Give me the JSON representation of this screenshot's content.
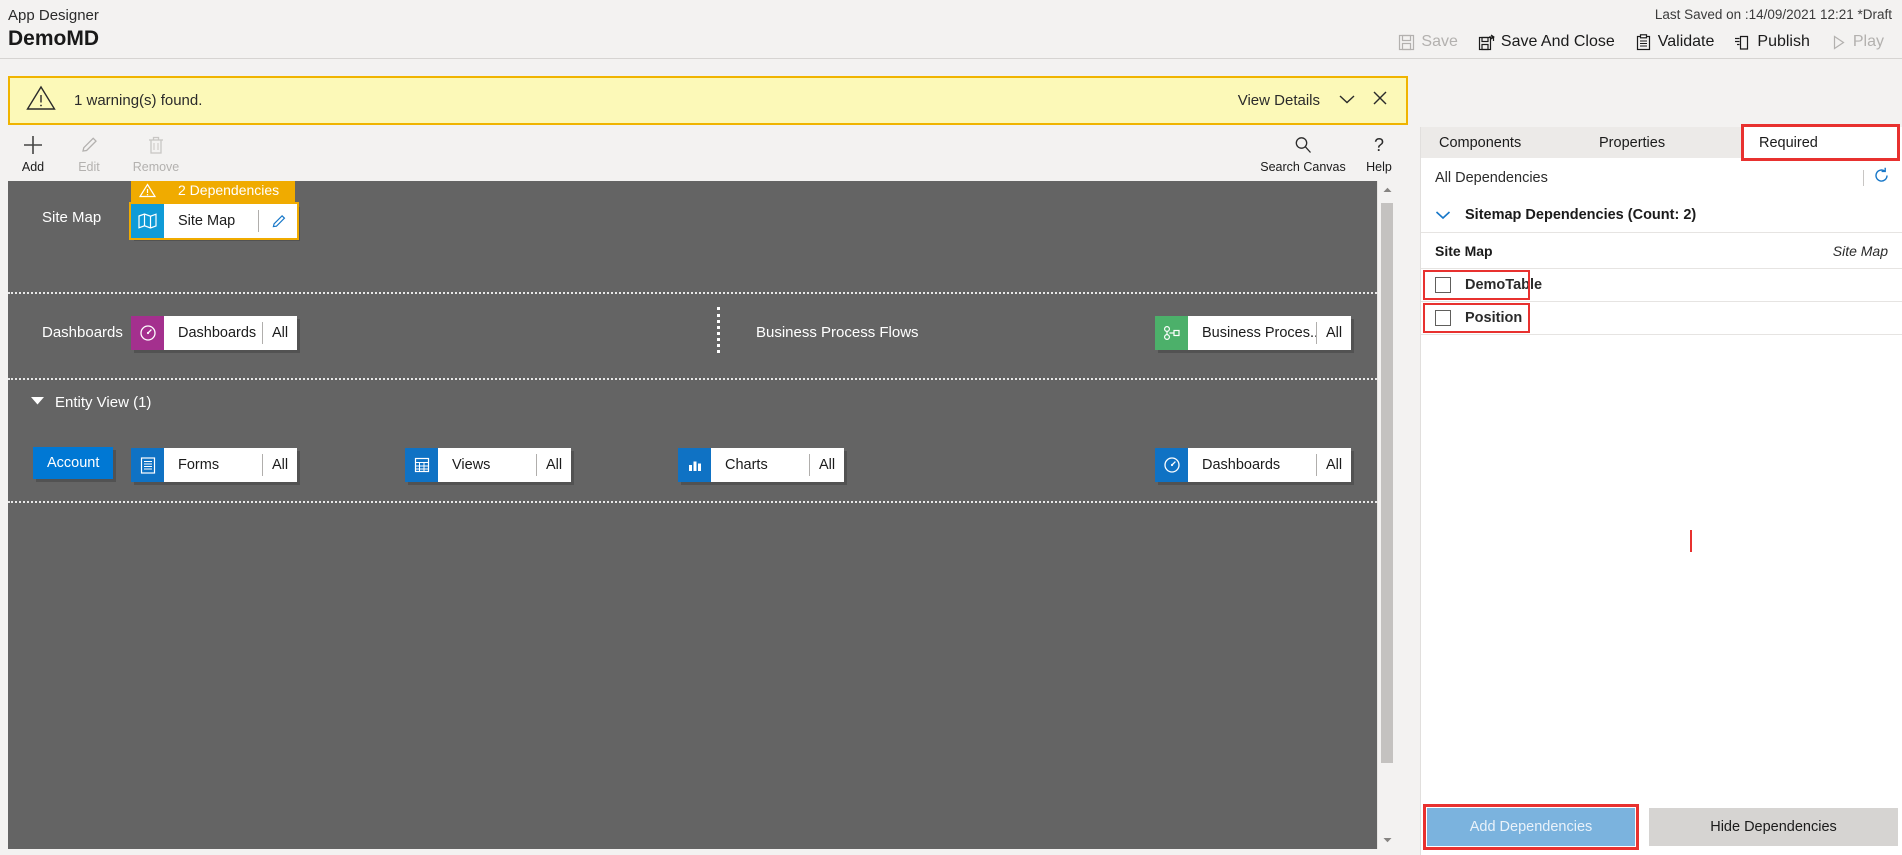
{
  "header": {
    "app_designer_label": "App Designer",
    "app_title": "DemoMD",
    "last_saved": "Last Saved on :14/09/2021 12:21 *Draft",
    "actions": [
      {
        "label": "Save",
        "icon": "save-icon",
        "disabled": true
      },
      {
        "label": "Save And Close",
        "icon": "save-and-close-icon",
        "disabled": false
      },
      {
        "label": "Validate",
        "icon": "validate-clipboard-icon",
        "disabled": false
      },
      {
        "label": "Publish",
        "icon": "publish-icon",
        "disabled": false
      },
      {
        "label": "Play",
        "icon": "play-icon",
        "disabled": true
      }
    ]
  },
  "warning": {
    "icon": "warning-triangle-icon",
    "message": "1 warning(s) found.",
    "view_details": "View Details",
    "chevron": "chevron-down-icon",
    "close": "close-icon"
  },
  "commandbar": {
    "items": [
      {
        "label": "Add",
        "icon": "plus-icon",
        "disabled": false
      },
      {
        "label": "Edit",
        "icon": "pencil-icon",
        "disabled": true
      },
      {
        "label": "Remove",
        "icon": "trash-icon",
        "disabled": true
      }
    ],
    "right_items": [
      {
        "label": "Search Canvas",
        "icon": "search-icon"
      },
      {
        "label": "Help",
        "icon": "question-mark-icon"
      }
    ]
  },
  "canvas": {
    "sitemap_row": {
      "row_label": "Site Map",
      "dependency_badge": "2 Dependencies",
      "tile_name": "Site Map",
      "tile_icon": "map-icon",
      "edit_icon": "pencil-icon"
    },
    "dashboards_row": {
      "row_label": "Dashboards",
      "tile_name": "Dashboards",
      "tile_icon": "dashboard-gauge-icon",
      "tile_all": "All",
      "bpf_label": "Business Process Flows",
      "bpf_tile_name": "Business Proces...",
      "bpf_tile_icon": "process-flow-icon",
      "bpf_tile_all": "All"
    },
    "entity_view": {
      "header": "Entity View (1)",
      "collapse_icon": "triangle-down-icon",
      "entity_name": "Account",
      "tiles": [
        {
          "name": "Forms",
          "icon": "forms-icon",
          "all": "All"
        },
        {
          "name": "Views",
          "icon": "views-grid-icon",
          "all": "All"
        },
        {
          "name": "Charts",
          "icon": "charts-bar-icon",
          "all": "All"
        },
        {
          "name": "Dashboards",
          "icon": "dashboard-gauge-icon",
          "all": "All"
        }
      ]
    }
  },
  "right_panel": {
    "tabs": [
      {
        "label": "Components",
        "active": false
      },
      {
        "label": "Properties",
        "active": false
      },
      {
        "label": "Required",
        "active": true
      }
    ],
    "all_dependencies_label": "All Dependencies",
    "refresh_icon": "refresh-icon",
    "sitemap_dependencies_label": "Sitemap Dependencies (Count: 2)",
    "sitemap_chevron": "chevron-down-icon",
    "grid_header": {
      "left": "Site Map",
      "right": "Site Map"
    },
    "rows": [
      {
        "name": "DemoTable",
        "checked": false
      },
      {
        "name": "Position",
        "checked": false
      }
    ],
    "footer": {
      "add_dependencies": "Add Dependencies",
      "hide_dependencies": "Hide Dependencies"
    }
  },
  "colors": {
    "accent_blue": "#0078d4",
    "warning_yellow": "#f0b400",
    "warning_bg": "#fcf9b8",
    "canvas_gray": "#646464",
    "dashboard_purple": "#a4308e",
    "bpf_green": "#4cb06a",
    "highlight_red": "#e8312f",
    "disabled_blue": "#7bb3de"
  }
}
